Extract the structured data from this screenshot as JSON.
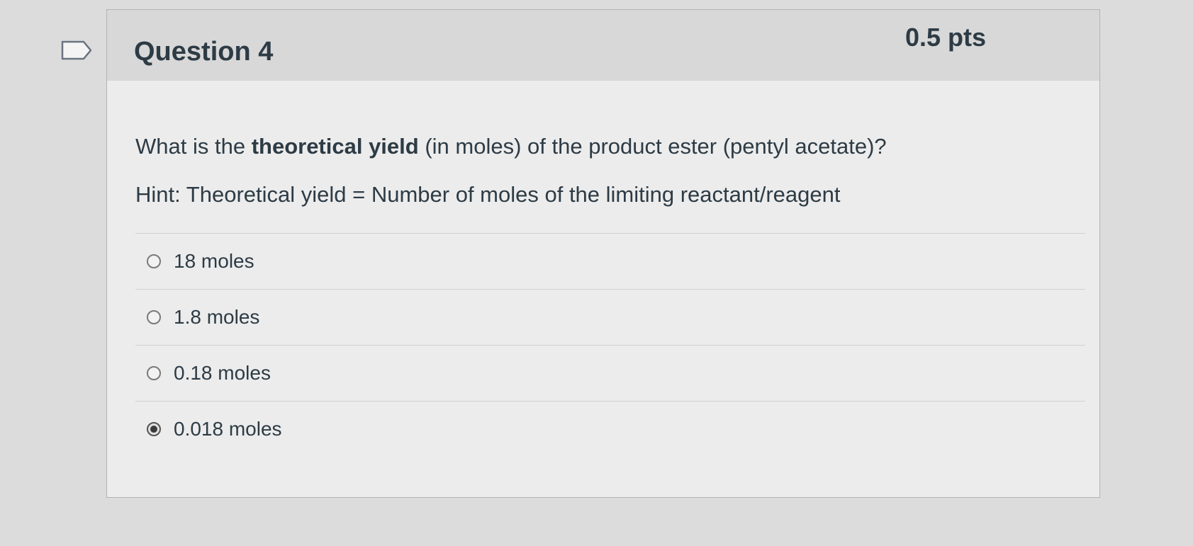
{
  "question": {
    "title": "Question 4",
    "points": "0.5 pts",
    "text_before": "What is the ",
    "text_bold": "theoretical yield",
    "text_after": " (in moles) of the product ester (pentyl acetate)?",
    "hint": "Hint: Theoretical yield = Number of moles of the limiting reactant/reagent",
    "answers": [
      {
        "label": "18 moles",
        "selected": false
      },
      {
        "label": "1.8 moles",
        "selected": false
      },
      {
        "label": "0.18 moles",
        "selected": false
      },
      {
        "label": "0.018 moles",
        "selected": true
      }
    ]
  },
  "icons": {
    "flag": "bookmark-flag-icon",
    "radio_unchecked": "radio-unchecked-icon",
    "radio_checked": "radio-checked-icon"
  },
  "colors": {
    "text": "#2d3b45",
    "header_bg": "#d8d8d8",
    "body_bg": "#ececec",
    "border": "#b3b3b3"
  }
}
